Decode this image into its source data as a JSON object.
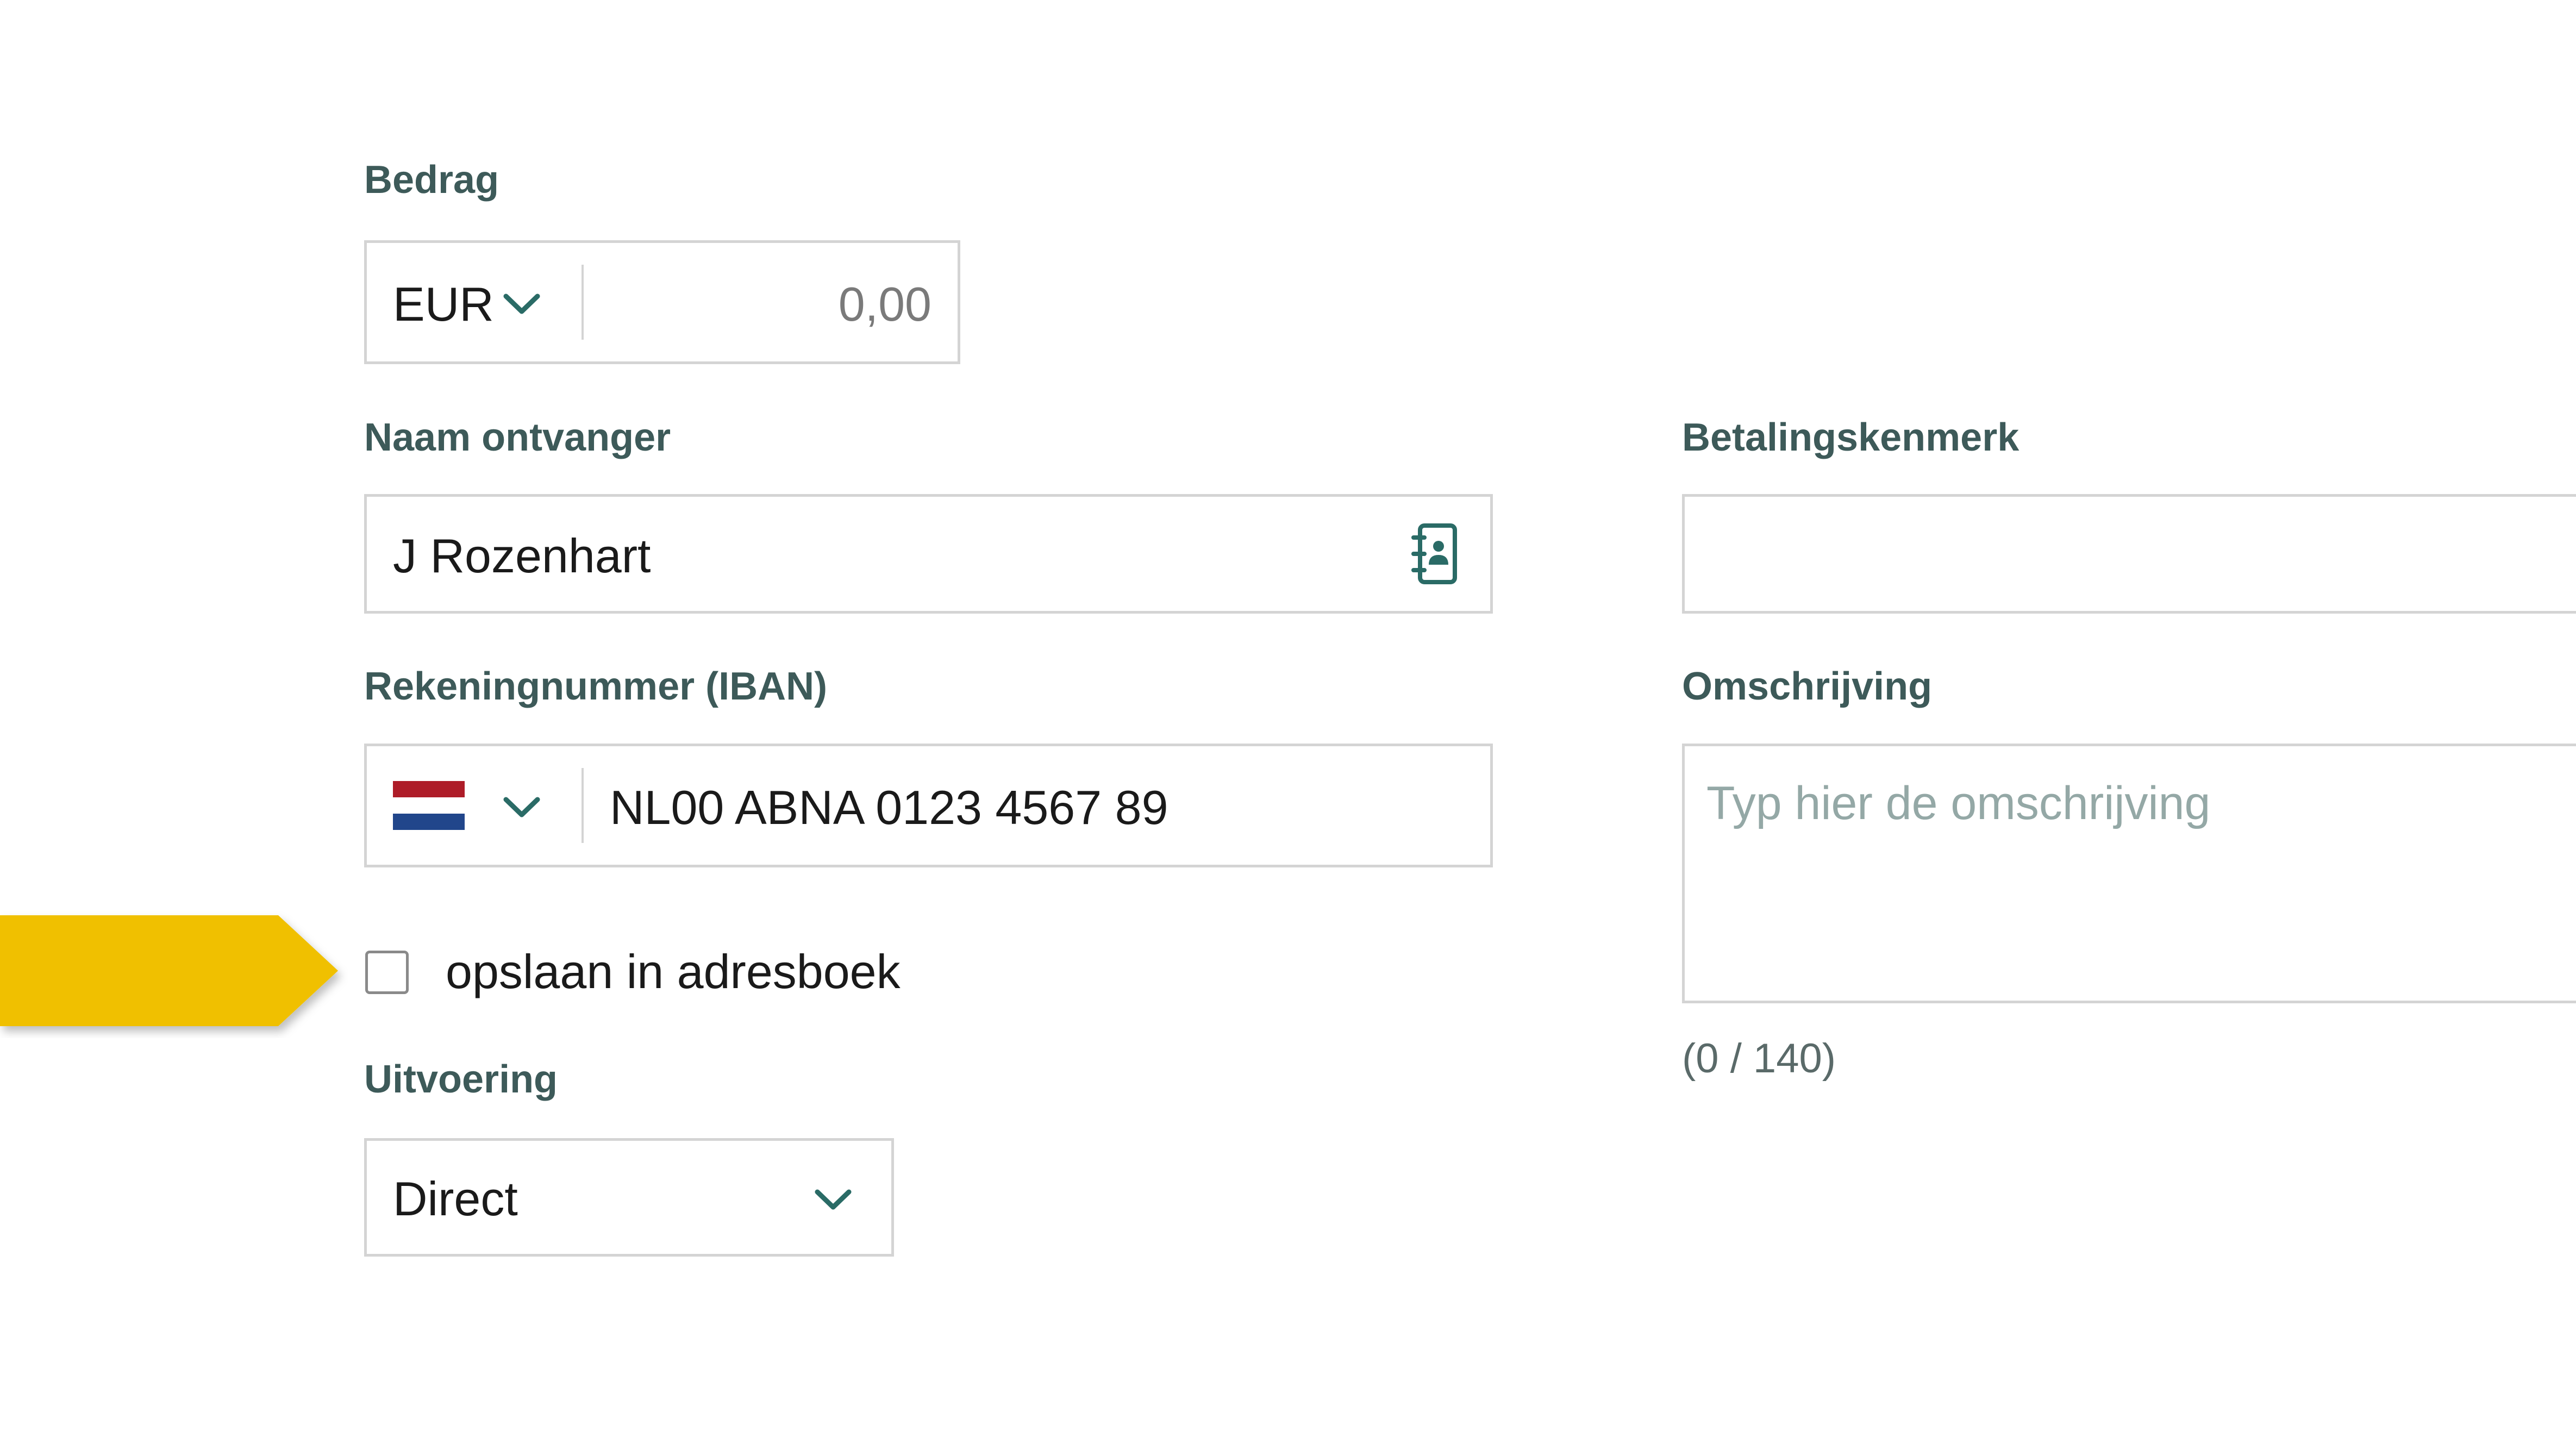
{
  "amount": {
    "label": "Bedrag",
    "currency": "EUR",
    "value": "0,00"
  },
  "recipient": {
    "label": "Naam ontvanger",
    "value": "J Rozenhart",
    "icon": "address-book-icon"
  },
  "iban": {
    "label": "Rekeningnummer (IBAN)",
    "country_flag": "netherlands-flag-icon",
    "value": "NL00 ABNA 0123 4567 89"
  },
  "save_to_addressbook": {
    "label": "opslaan in adresboek",
    "checked": false
  },
  "execution": {
    "label": "Uitvoering",
    "selected": "Direct"
  },
  "payment_reference": {
    "label": "Betalingskenmerk",
    "value": ""
  },
  "description": {
    "label": "Omschrijving",
    "placeholder": "Typ hier de omschrijving",
    "counter": "(0 / 140)"
  },
  "colors": {
    "label": "#3d5a59",
    "accent": "#2a6b66",
    "border": "#d4d4d4",
    "pointer": "#f0c000"
  }
}
